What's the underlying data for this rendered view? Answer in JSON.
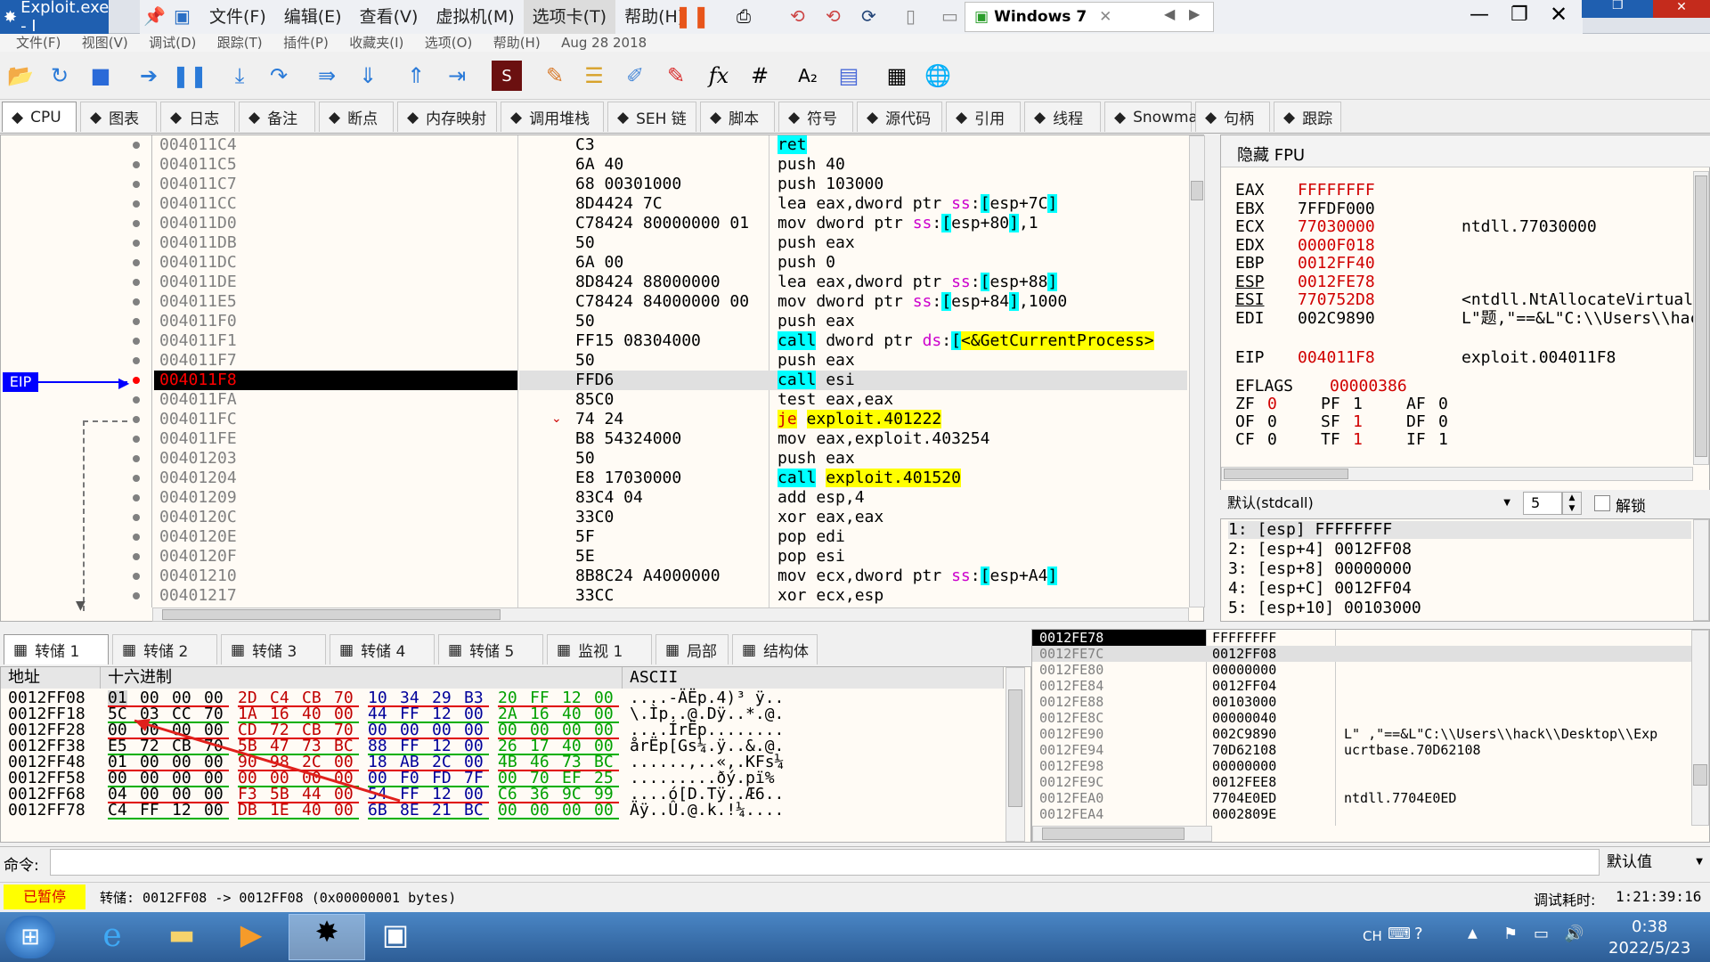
{
  "window": {
    "title": "Exploit.exe - I",
    "vm_name": "Windows 7"
  },
  "vm_menu": [
    "文件(F)",
    "编辑(E)",
    "查看(V)",
    "虚拟机(M)",
    "选项卡(T)",
    "帮助(H)"
  ],
  "app_menu": [
    "文件(F)",
    "视图(V)",
    "调试(D)",
    "跟踪(T)",
    "插件(P)",
    "收藏夹(I)",
    "选项(O)",
    "帮助(H)",
    "Aug 28 2018"
  ],
  "tabs": [
    {
      "label": "CPU",
      "icon": "cpu-icon"
    },
    {
      "label": "图表",
      "icon": "graph-icon"
    },
    {
      "label": "日志",
      "icon": "log-icon"
    },
    {
      "label": "备注",
      "icon": "notes-icon"
    },
    {
      "label": "断点",
      "icon": "breakpoint-icon"
    },
    {
      "label": "内存映射",
      "icon": "memory-icon"
    },
    {
      "label": "调用堆栈",
      "icon": "callstack-icon"
    },
    {
      "label": "SEH 链",
      "icon": "seh-icon"
    },
    {
      "label": "脚本",
      "icon": "script-icon"
    },
    {
      "label": "符号",
      "icon": "symbol-icon"
    },
    {
      "label": "源代码",
      "icon": "source-icon"
    },
    {
      "label": "引用",
      "icon": "references-icon"
    },
    {
      "label": "线程",
      "icon": "threads-icon"
    },
    {
      "label": "Snowman",
      "icon": "snowman-icon"
    },
    {
      "label": "句柄",
      "icon": "handles-icon"
    },
    {
      "label": "跟踪",
      "icon": "trace-icon"
    }
  ],
  "eip_label": "EIP",
  "disasm": [
    {
      "addr": "004011C4",
      "bytes": "C3",
      "instr": "ret"
    },
    {
      "addr": "004011C5",
      "bytes": "6A 40",
      "instr": "push 40"
    },
    {
      "addr": "004011C7",
      "bytes": "68 00301000",
      "instr": "push 103000"
    },
    {
      "addr": "004011CC",
      "bytes": "8D4424 7C",
      "instr": "lea eax,dword ptr ss:[esp+7C]"
    },
    {
      "addr": "004011D0",
      "bytes": "C78424 80000000 01",
      "instr": "mov dword ptr ss:[esp+80],1"
    },
    {
      "addr": "004011DB",
      "bytes": "50",
      "instr": "push eax"
    },
    {
      "addr": "004011DC",
      "bytes": "6A 00",
      "instr": "push 0"
    },
    {
      "addr": "004011DE",
      "bytes": "8D8424 88000000",
      "instr": "lea eax,dword ptr ss:[esp+88]"
    },
    {
      "addr": "004011E5",
      "bytes": "C78424 84000000 00",
      "instr": "mov dword ptr ss:[esp+84],1000"
    },
    {
      "addr": "004011F0",
      "bytes": "50",
      "instr": "push eax"
    },
    {
      "addr": "004011F1",
      "bytes": "FF15 08304000",
      "instr": "call dword ptr ds:[<&GetCurrentProcess>"
    },
    {
      "addr": "004011F7",
      "bytes": "50",
      "instr": "push eax"
    },
    {
      "addr": "004011F8",
      "bytes": "FFD6",
      "instr": "call esi"
    },
    {
      "addr": "004011FA",
      "bytes": "85C0",
      "instr": "test eax,eax"
    },
    {
      "addr": "004011FC",
      "bytes": "74 24",
      "instr": "je exploit.401222"
    },
    {
      "addr": "004011FE",
      "bytes": "B8 54324000",
      "instr": "mov eax,exploit.403254"
    },
    {
      "addr": "00401203",
      "bytes": "50",
      "instr": "push eax"
    },
    {
      "addr": "00401204",
      "bytes": "E8 17030000",
      "instr": "call exploit.401520"
    },
    {
      "addr": "00401209",
      "bytes": "83C4 04",
      "instr": "add esp,4"
    },
    {
      "addr": "0040120C",
      "bytes": "33C0",
      "instr": "xor eax,eax"
    },
    {
      "addr": "0040120E",
      "bytes": "5F",
      "instr": "pop edi"
    },
    {
      "addr": "0040120F",
      "bytes": "5E",
      "instr": "pop esi"
    },
    {
      "addr": "00401210",
      "bytes": "8B8C24 A4000000",
      "instr": "mov ecx,dword ptr ss:[esp+A4]"
    },
    {
      "addr": "00401217",
      "bytes": "33CC",
      "instr": "xor ecx,esp"
    }
  ],
  "regs": {
    "header": "隐藏 FPU",
    "gp": [
      {
        "n": "EAX",
        "v": "FFFFFFFF",
        "c": ""
      },
      {
        "n": "EBX",
        "v": "7FFDF000",
        "c": ""
      },
      {
        "n": "ECX",
        "v": "77030000",
        "c": "ntdll.77030000"
      },
      {
        "n": "EDX",
        "v": "0000F018",
        "c": ""
      },
      {
        "n": "EBP",
        "v": "0012FF40",
        "c": ""
      },
      {
        "n": "ESP",
        "v": "0012FE78",
        "c": ""
      },
      {
        "n": "ESI",
        "v": "770752D8",
        "c": "<ntdll.NtAllocateVirtual"
      },
      {
        "n": "EDI",
        "v": "002C9890",
        "c": "L\"题,\"==&L\"C:\\\\Users\\\\hac"
      }
    ],
    "eip": {
      "n": "EIP",
      "v": "004011F8",
      "c": "exploit.004011F8"
    },
    "eflags": {
      "n": "EFLAGS",
      "v": "00000386"
    },
    "flags": [
      [
        "ZF",
        "0"
      ],
      [
        "PF",
        "1"
      ],
      [
        "AF",
        "0"
      ],
      [
        "OF",
        "0"
      ],
      [
        "SF",
        "1"
      ],
      [
        "DF",
        "0"
      ],
      [
        "CF",
        "0"
      ],
      [
        "TF",
        "1"
      ],
      [
        "IF",
        "1"
      ]
    ]
  },
  "callconv": {
    "label": "默认(stdcall)",
    "count": "5",
    "unlock": "解锁"
  },
  "args": [
    "1:  [esp] FFFFFFFF",
    "2:  [esp+4] 0012FF08",
    "3:  [esp+8] 00000000",
    "4:  [esp+C] 0012FF04",
    "5:  [esp+10] 00103000"
  ],
  "dump_tabs": [
    "转储 1",
    "转储 2",
    "转储 3",
    "转储 4",
    "转储 5",
    "监视 1",
    "局部",
    "结构体"
  ],
  "dump_headers": {
    "addr": "地址",
    "hex": "十六进制",
    "ascii": "ASCII"
  },
  "dump": [
    {
      "a": "0012FF08",
      "h": [
        "01",
        "00",
        "00",
        "00",
        "2D",
        "C4",
        "CB",
        "70",
        "10",
        "34",
        "29",
        "B3",
        "20",
        "FF",
        "12",
        "00"
      ],
      "s": "....-ÄËp.4)³ ÿ.."
    },
    {
      "a": "0012FF18",
      "h": [
        "5C",
        "03",
        "CC",
        "70",
        "1A",
        "16",
        "40",
        "00",
        "44",
        "FF",
        "12",
        "00",
        "2A",
        "16",
        "40",
        "00"
      ],
      "s": "\\.Ìp..@.Dÿ..*.@."
    },
    {
      "a": "0012FF28",
      "h": [
        "00",
        "00",
        "00",
        "00",
        "CD",
        "72",
        "CB",
        "70",
        "00",
        "00",
        "00",
        "00",
        "00",
        "00",
        "00",
        "00"
      ],
      "s": "....ÍrËp........"
    },
    {
      "a": "0012FF38",
      "h": [
        "E5",
        "72",
        "CB",
        "70",
        "5B",
        "47",
        "73",
        "BC",
        "88",
        "FF",
        "12",
        "00",
        "26",
        "17",
        "40",
        "00"
      ],
      "s": "årËp[Gs¼.ÿ..&.@."
    },
    {
      "a": "0012FF48",
      "h": [
        "01",
        "00",
        "00",
        "00",
        "90",
        "98",
        "2C",
        "00",
        "18",
        "AB",
        "2C",
        "00",
        "4B",
        "46",
        "73",
        "BC"
      ],
      "s": "......,..«,.KFs¼"
    },
    {
      "a": "0012FF58",
      "h": [
        "00",
        "00",
        "00",
        "00",
        "00",
        "00",
        "00",
        "00",
        "00",
        "F0",
        "FD",
        "7F",
        "00",
        "70",
        "EF",
        "25"
      ],
      "s": ".........ðý.pï%"
    },
    {
      "a": "0012FF68",
      "h": [
        "04",
        "00",
        "00",
        "00",
        "F3",
        "5B",
        "44",
        "00",
        "54",
        "FF",
        "12",
        "00",
        "C6",
        "36",
        "9C",
        "99"
      ],
      "s": "....ó[D.Tÿ..Æ6.."
    },
    {
      "a": "0012FF78",
      "h": [
        "C4",
        "FF",
        "12",
        "00",
        "DB",
        "1E",
        "40",
        "00",
        "6B",
        "8E",
        "21",
        "BC",
        "00",
        "00",
        "00",
        "00"
      ],
      "s": "Äÿ..Û.@.k.!¼...."
    }
  ],
  "stack": [
    {
      "a": "0012FE78",
      "v": "FFFFFFFF",
      "c": ""
    },
    {
      "a": "0012FE7C",
      "v": "0012FF08",
      "c": ""
    },
    {
      "a": "0012FE80",
      "v": "00000000",
      "c": ""
    },
    {
      "a": "0012FE84",
      "v": "0012FF04",
      "c": ""
    },
    {
      "a": "0012FE88",
      "v": "00103000",
      "c": ""
    },
    {
      "a": "0012FE8C",
      "v": "00000040",
      "c": ""
    },
    {
      "a": "0012FE90",
      "v": "002C9890",
      "c": "L\"  ,\"==&L\"C:\\\\Users\\\\hack\\\\Desktop\\\\Exp"
    },
    {
      "a": "0012FE94",
      "v": "70D62108",
      "c": "ucrtbase.70D62108"
    },
    {
      "a": "0012FE98",
      "v": "00000000",
      "c": ""
    },
    {
      "a": "0012FE9C",
      "v": "0012FEE8",
      "c": ""
    },
    {
      "a": "0012FEA0",
      "v": "7704E0ED",
      "c": "ntdll.7704E0ED"
    },
    {
      "a": "0012FEA4",
      "v": "0002809E",
      "c": ""
    }
  ],
  "command": {
    "label": "命令:",
    "default": "默认值"
  },
  "status": {
    "state": "已暂停",
    "message": "转储: 0012FF08 -> 0012FF08 (0x00000001 bytes)",
    "time_label": "调试耗时:",
    "time": "1:21:39:16"
  },
  "taskbar": {
    "lang": "CH",
    "time": "0:38",
    "date": "2022/5/23"
  },
  "colors": {
    "eip_row": "#000000",
    "eip_addr": "#ff0000",
    "highlight": "#00ffff",
    "yellow": "#ffff00",
    "reg_changed": "#d00000"
  }
}
